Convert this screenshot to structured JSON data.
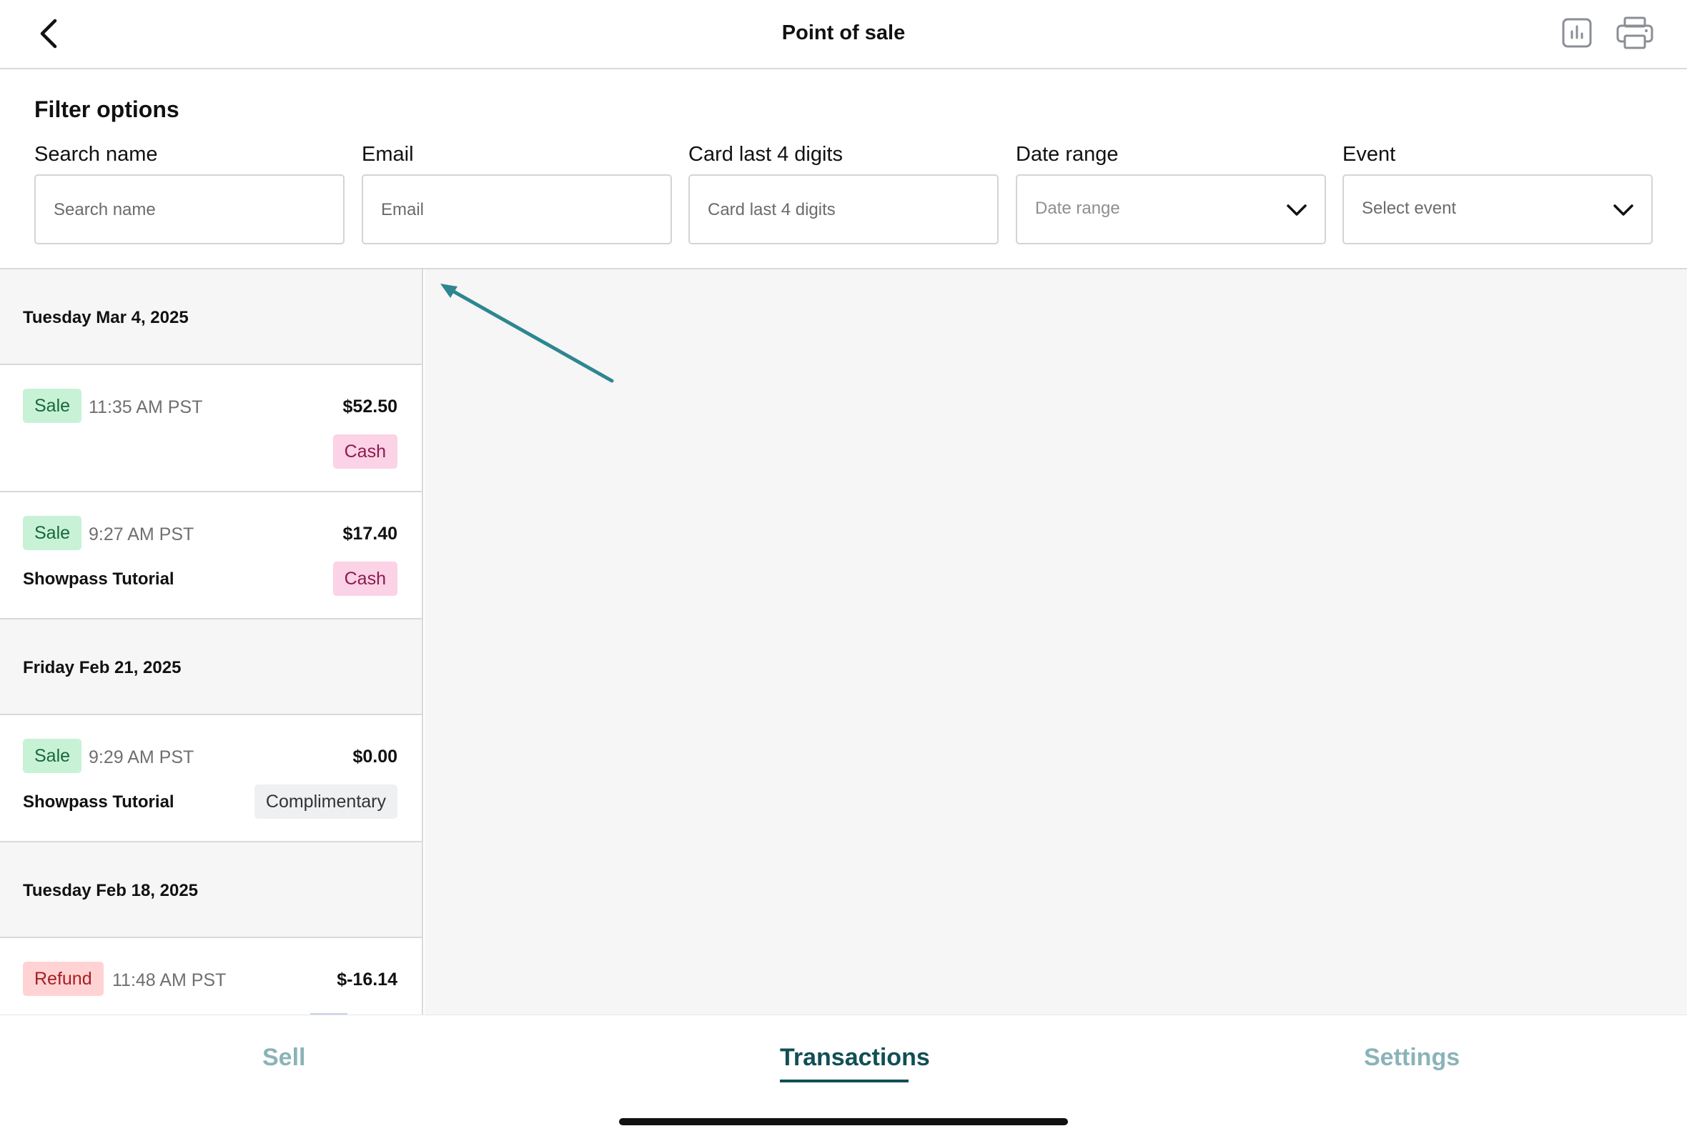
{
  "header": {
    "title": "Point of sale"
  },
  "filters": {
    "title": "Filter options",
    "fields": [
      {
        "label": "Search name",
        "placeholder": "Search name",
        "type": "text"
      },
      {
        "label": "Email",
        "placeholder": "Email",
        "type": "text"
      },
      {
        "label": "Card last 4 digits",
        "placeholder": "Card last 4 digits",
        "type": "text"
      },
      {
        "label": "Date range",
        "placeholder": "Date range",
        "type": "select"
      },
      {
        "label": "Event",
        "placeholder": "Select event",
        "type": "select"
      }
    ]
  },
  "transactions": {
    "groups": [
      {
        "date": "Tuesday Mar 4, 2025",
        "items": [
          {
            "type": "Sale",
            "time": "11:35 AM PST",
            "amount": "$52.50",
            "event": "",
            "payment": "Cash"
          },
          {
            "type": "Sale",
            "time": "9:27 AM PST",
            "amount": "$17.40",
            "event": "Showpass Tutorial",
            "payment": "Cash"
          }
        ]
      },
      {
        "date": "Friday Feb 21, 2025",
        "items": [
          {
            "type": "Sale",
            "time": "9:29 AM PST",
            "amount": "$0.00",
            "event": "Showpass Tutorial",
            "payment": "Complimentary"
          }
        ]
      },
      {
        "date": "Tuesday Feb 18, 2025",
        "items": [
          {
            "type": "Refund",
            "time": "11:48 AM PST",
            "amount": "$-16.14",
            "event": "",
            "payment": ""
          }
        ]
      }
    ]
  },
  "nav": {
    "sell": "Sell",
    "transactions": "Transactions",
    "settings": "Settings",
    "active": "transactions"
  },
  "colors": {
    "accent": "#114f55",
    "accent_inactive": "#8ab3b8",
    "arrow": "#2e8690",
    "sale_badge_bg": "#c8f2d6",
    "refund_badge_bg": "#ffd3d3",
    "cash_badge_bg": "#fbd2e6",
    "comp_badge_bg": "#eff0f2"
  },
  "icons": {
    "back": "chevron-left-icon",
    "report": "bar-chart-icon",
    "print": "printer-icon",
    "dropdown": "chevron-down-icon"
  }
}
